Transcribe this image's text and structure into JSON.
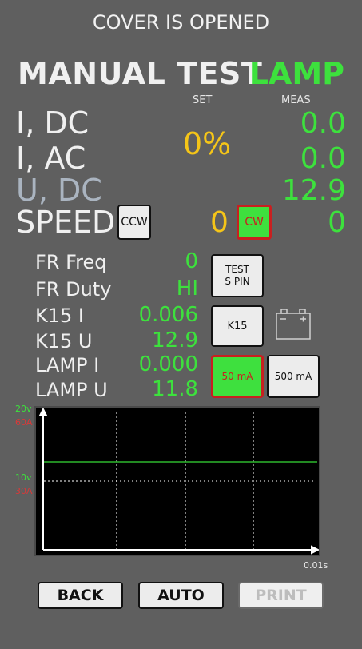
{
  "header": {
    "status": "COVER IS OPENED"
  },
  "title": {
    "text": "MANUAL TEST",
    "mode": "LAMP"
  },
  "columns": {
    "set": "SET",
    "meas": "MEAS"
  },
  "main": {
    "i_dc": {
      "label": "I, DC",
      "meas": "0.0"
    },
    "i_ac": {
      "label": "I, AC",
      "meas": "0.0"
    },
    "set_percent": "0%",
    "u_dc": {
      "label": "U, DC",
      "meas": "12.9"
    },
    "speed": {
      "label": "SPEED",
      "set": "0",
      "meas": "0",
      "ccw_label": "CCW",
      "cw_label": "CW"
    }
  },
  "details": {
    "fr_freq": {
      "label": "FR Freq",
      "value": "0"
    },
    "fr_duty": {
      "label": "FR Duty",
      "value": "HI"
    },
    "k15_i": {
      "label": "K15 I",
      "value": "0.006"
    },
    "k15_u": {
      "label": "K15 U",
      "value": "12.9"
    },
    "lamp_i": {
      "label": "LAMP I",
      "value": "0.000"
    },
    "lamp_u": {
      "label": "LAMP U",
      "value": "11.8"
    }
  },
  "buttons": {
    "test_s_pin_line1": "TEST",
    "test_s_pin_line2": "S PIN",
    "k15": "K15",
    "ma50": "50 mA",
    "ma500": "500 mA"
  },
  "graph": {
    "y_top_v": "20v",
    "y_top_a": "60A",
    "y_mid_v": "10v",
    "y_mid_a": "30A",
    "x_label": "0.01s",
    "colors": {
      "trace": "#2db82d",
      "grid": "#ffffff"
    }
  },
  "footer": {
    "back": "BACK",
    "auto": "AUTO",
    "print": "PRINT"
  },
  "icons": {
    "battery": "battery-icon"
  },
  "colors": {
    "green": "#3de13d",
    "yellow": "#f5c518",
    "red": "#c82020",
    "bg": "#5f5f5f"
  }
}
